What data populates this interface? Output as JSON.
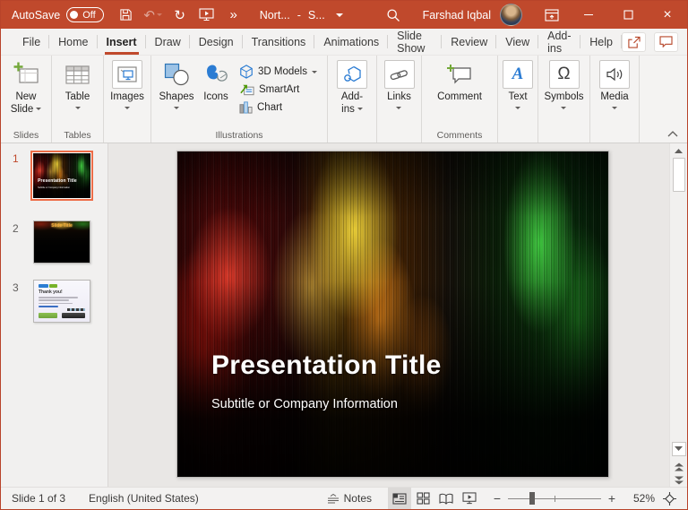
{
  "glyphs": {
    "undo": "↶",
    "redo": "↻",
    "more": "»",
    "close": "×",
    "omega": "Ω",
    "text_a": "A"
  },
  "titlebar": {
    "autosave_label": "AutoSave",
    "autosave_state": "Off",
    "doc_title": "Nort...",
    "doc_separator": "-",
    "doc_suffix": "S...",
    "user_name": "Farshad Iqbal"
  },
  "tabs": [
    {
      "label": "File"
    },
    {
      "label": "Home"
    },
    {
      "label": "Insert",
      "active": true
    },
    {
      "label": "Draw"
    },
    {
      "label": "Design"
    },
    {
      "label": "Transitions"
    },
    {
      "label": "Animations"
    },
    {
      "label": "Slide Show"
    },
    {
      "label": "Review"
    },
    {
      "label": "View"
    },
    {
      "label": "Add-ins"
    },
    {
      "label": "Help"
    }
  ],
  "ribbon": {
    "buttons": {
      "new_slide": "New Slide",
      "table": "Table",
      "images": "Images",
      "shapes": "Shapes",
      "icons": "Icons",
      "models_3d": "3D Models",
      "smartart": "SmartArt",
      "chart": "Chart",
      "addins": "Add-ins",
      "links": "Links",
      "comment": "Comment",
      "text": "Text",
      "symbols": "Symbols",
      "media": "Media"
    },
    "group_labels": {
      "slides": "Slides",
      "tables": "Tables",
      "illustrations": "Illustrations",
      "comments": "Comments"
    }
  },
  "thumbnails": [
    {
      "number": "1",
      "selected": true,
      "title": "Presentation Title",
      "subtitle": "Subtitle or Company Information"
    },
    {
      "number": "2",
      "selected": false,
      "title": "Slide Title"
    },
    {
      "number": "3",
      "selected": false,
      "title": "Thank you!"
    }
  ],
  "slide": {
    "title": "Presentation Title",
    "subtitle": "Subtitle or Company Information"
  },
  "statusbar": {
    "slide_indicator": "Slide 1 of 3",
    "language": "English (United States)",
    "notes_label": "Notes",
    "zoom_out": "−",
    "zoom_in": "+",
    "zoom_level": "52%"
  }
}
